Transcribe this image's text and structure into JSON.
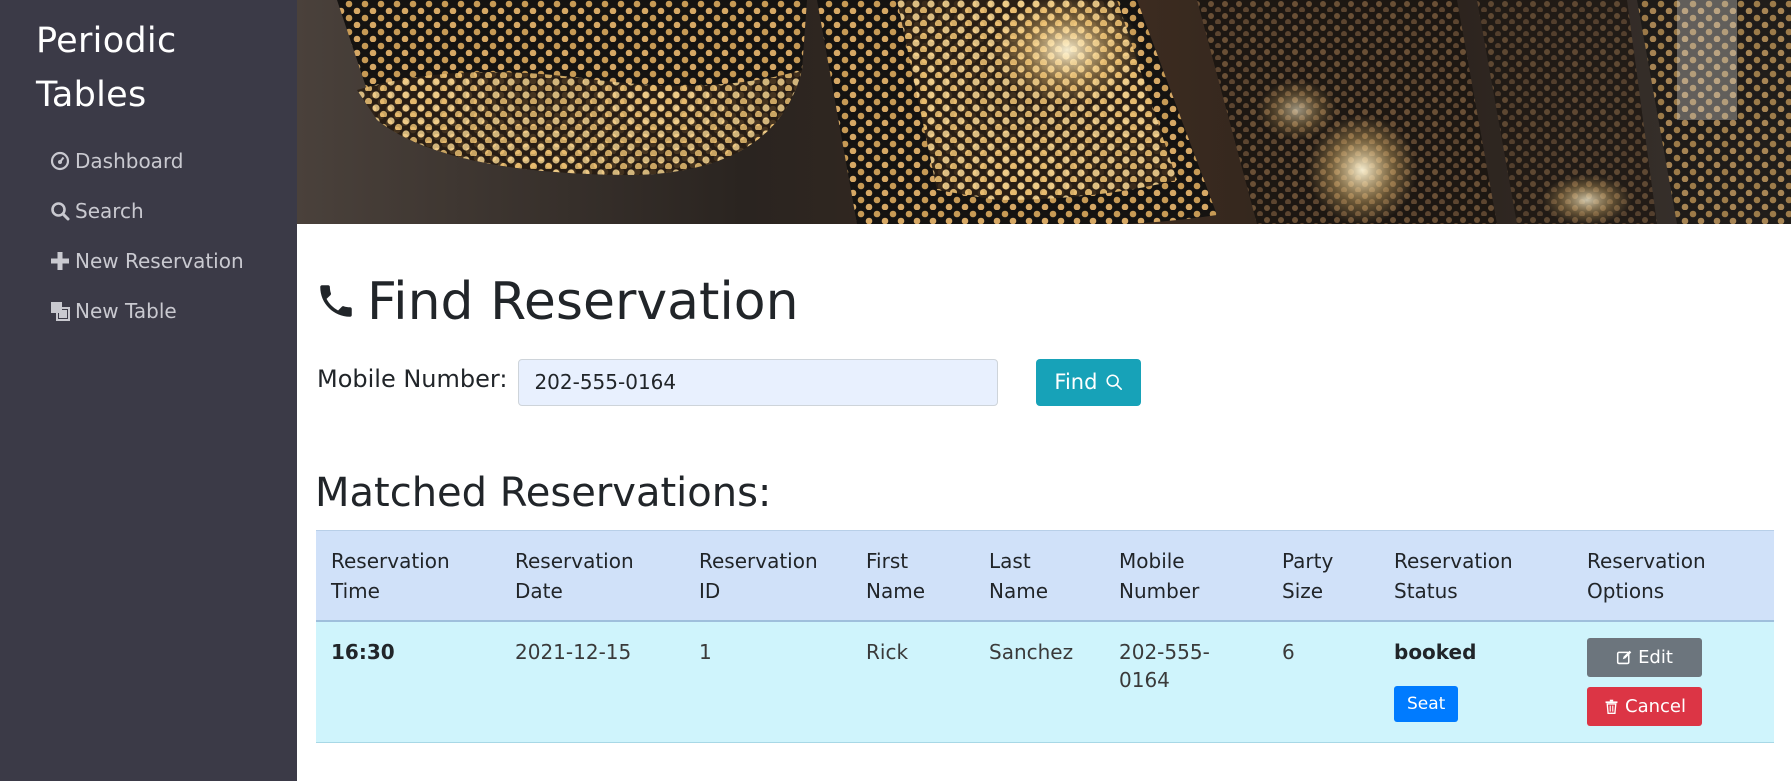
{
  "sidebar": {
    "brand_line1": "Periodic",
    "brand_line2": "Tables",
    "items": [
      {
        "label": "Dashboard",
        "icon": "dashboard-icon"
      },
      {
        "label": "Search",
        "icon": "search-icon"
      },
      {
        "label": "New Reservation",
        "icon": "plus-icon"
      },
      {
        "label": "New Table",
        "icon": "table-icon"
      }
    ]
  },
  "banner": {
    "image": "pendant-lamps-photo"
  },
  "page": {
    "title": "Find Reservation",
    "title_icon": "phone-icon"
  },
  "search": {
    "label": "Mobile Number:",
    "value": "202-555-0164",
    "button_label": "Find"
  },
  "results": {
    "title": "Matched Reservations:",
    "columns": [
      {
        "line1": "Reservation",
        "line2": "Time"
      },
      {
        "line1": "Reservation",
        "line2": "Date"
      },
      {
        "line1": "Reservation",
        "line2": "ID"
      },
      {
        "line1": "First",
        "line2": "Name"
      },
      {
        "line1": "Last",
        "line2": "Name"
      },
      {
        "line1": "Mobile",
        "line2": "Number"
      },
      {
        "line1": "Party",
        "line2": "Size"
      },
      {
        "line1": "Reservation",
        "line2": "Status"
      },
      {
        "line1": "Reservation",
        "line2": "Options"
      }
    ],
    "rows": [
      {
        "time": "16:30",
        "date": "2021-12-15",
        "id": "1",
        "first_name": "Rick",
        "last_name": "Sanchez",
        "mobile": "202-555-0164",
        "party_size": "6",
        "status": "booked",
        "seat_label": "Seat",
        "edit_label": "Edit",
        "cancel_label": "Cancel"
      }
    ]
  },
  "colors": {
    "sidebar_bg": "#3b3a47",
    "find_button": "#17a2b8",
    "seat_button": "#007bff",
    "edit_button": "#6c757d",
    "cancel_button": "#dc3545",
    "header_row": "#d0e1f9",
    "body_row": "#cff4fc"
  }
}
